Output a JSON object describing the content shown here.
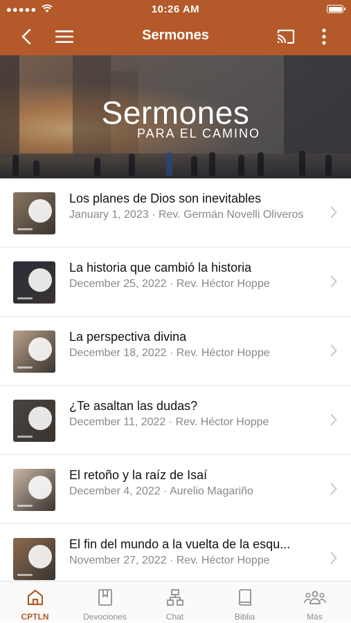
{
  "status_bar": {
    "time": "10:26 AM",
    "signal": "●●●●●",
    "battery_level": 1.0
  },
  "nav": {
    "title": "Sermones"
  },
  "banner": {
    "title": "Sermones",
    "subtitle": "PARA EL CAMINO"
  },
  "sermons": [
    {
      "title": "Los planes de Dios son inevitables",
      "date": "January 1, 2023",
      "speaker": "Rev. Germán Novelli Oliveros",
      "subtitle": "January 1, 2023 · Rev. Germán Novelli Oliveros",
      "thumb_color": "#8a7660"
    },
    {
      "title": "La historia que cambió la historia",
      "date": "December 25, 2022",
      "speaker": "Rev. Héctor Hoppe",
      "subtitle": "December 25, 2022 · Rev. Héctor Hoppe",
      "thumb_color": "#2b2d3a"
    },
    {
      "title": "La perspectiva divina",
      "date": "December 18, 2022",
      "speaker": "Rev. Héctor Hoppe",
      "subtitle": "December 18, 2022 · Rev. Héctor Hoppe",
      "thumb_color": "#b9a28a"
    },
    {
      "title": "¿Te asaltan las dudas?",
      "date": "December 11, 2022",
      "speaker": "Rev. Héctor Hoppe",
      "subtitle": "December 11, 2022 · Rev. Héctor Hoppe",
      "thumb_color": "#4a4440"
    },
    {
      "title": "El retoño y la raíz de Isaí",
      "date": "December 4, 2022",
      "speaker": "Aurelio Magariño",
      "subtitle": "December 4, 2022 · Aurelio Magariño",
      "thumb_color": "#c9b8a6"
    },
    {
      "title": "El fin del mundo a la vuelta de la esqu...",
      "date": "November 27, 2022",
      "speaker": "Rev. Héctor Hoppe",
      "subtitle": "November 27, 2022 · Rev. Héctor Hoppe",
      "thumb_color": "#8c6a4e"
    }
  ],
  "tabs": [
    {
      "label": "CPTLN",
      "icon": "home-icon",
      "active": true
    },
    {
      "label": "Devociones",
      "icon": "bookmark-book-icon",
      "active": false
    },
    {
      "label": "Chat",
      "icon": "org-chart-icon",
      "active": false
    },
    {
      "label": "Biblia",
      "icon": "book-icon",
      "active": false
    },
    {
      "label": "Más",
      "icon": "people-group-icon",
      "active": false
    }
  ],
  "colors": {
    "brand": "#b4592a",
    "inactive_tab": "#8e8e93",
    "subtitle_text": "#888888"
  }
}
